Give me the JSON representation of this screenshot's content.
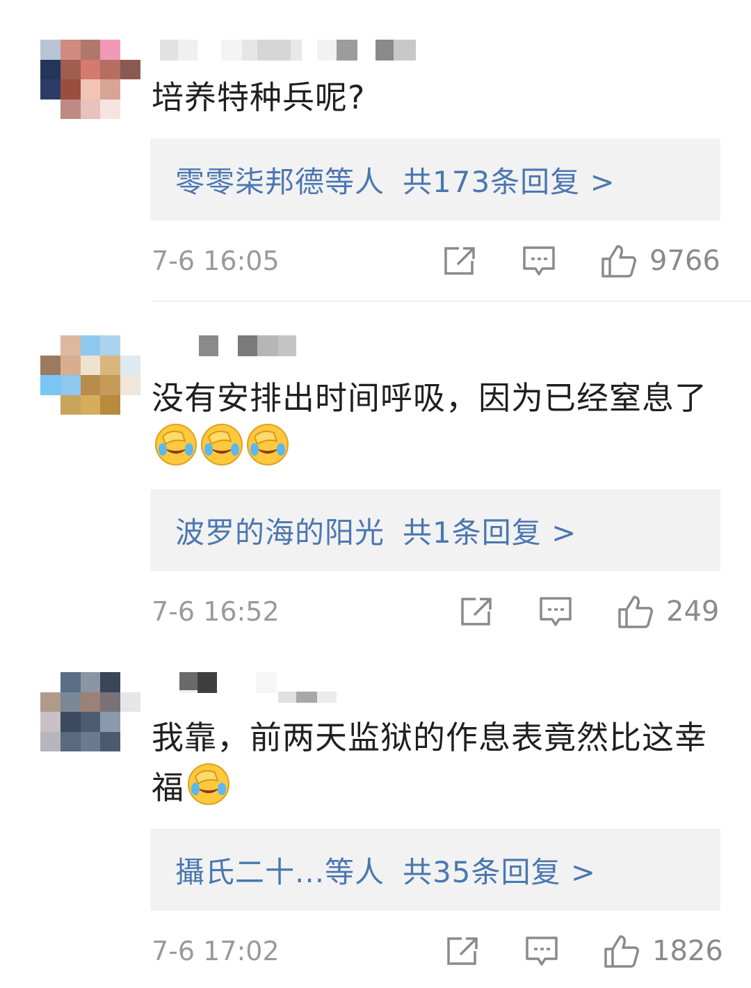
{
  "comments": [
    {
      "text": "培养特种兵呢?",
      "reply_users": "零零柒邦德等人",
      "reply_count": "共173条回复 >",
      "time": "7-6 16:05",
      "likes": "9766"
    },
    {
      "text": "没有安排出时间呼吸，因为已经窒息了",
      "reply_users": "波罗的海的阳光",
      "reply_count": "共1条回复 >",
      "time": "7-6 16:52",
      "likes": "249"
    },
    {
      "text": "我靠，前两天监狱的作息表竟然比这幸福",
      "reply_users": "攝氏二十...等人",
      "reply_count": "共35条回复 >",
      "time": "7-6 17:02",
      "likes": "1826"
    }
  ],
  "icons": {
    "share": "share-icon",
    "comment": "comment-icon",
    "like": "thumbs-up-icon",
    "emoji": "facepalm-laughing-emoji"
  },
  "colors": {
    "link": "#4a77b0",
    "meta": "#9a9a9a",
    "reply_bg": "#f2f2f2"
  }
}
